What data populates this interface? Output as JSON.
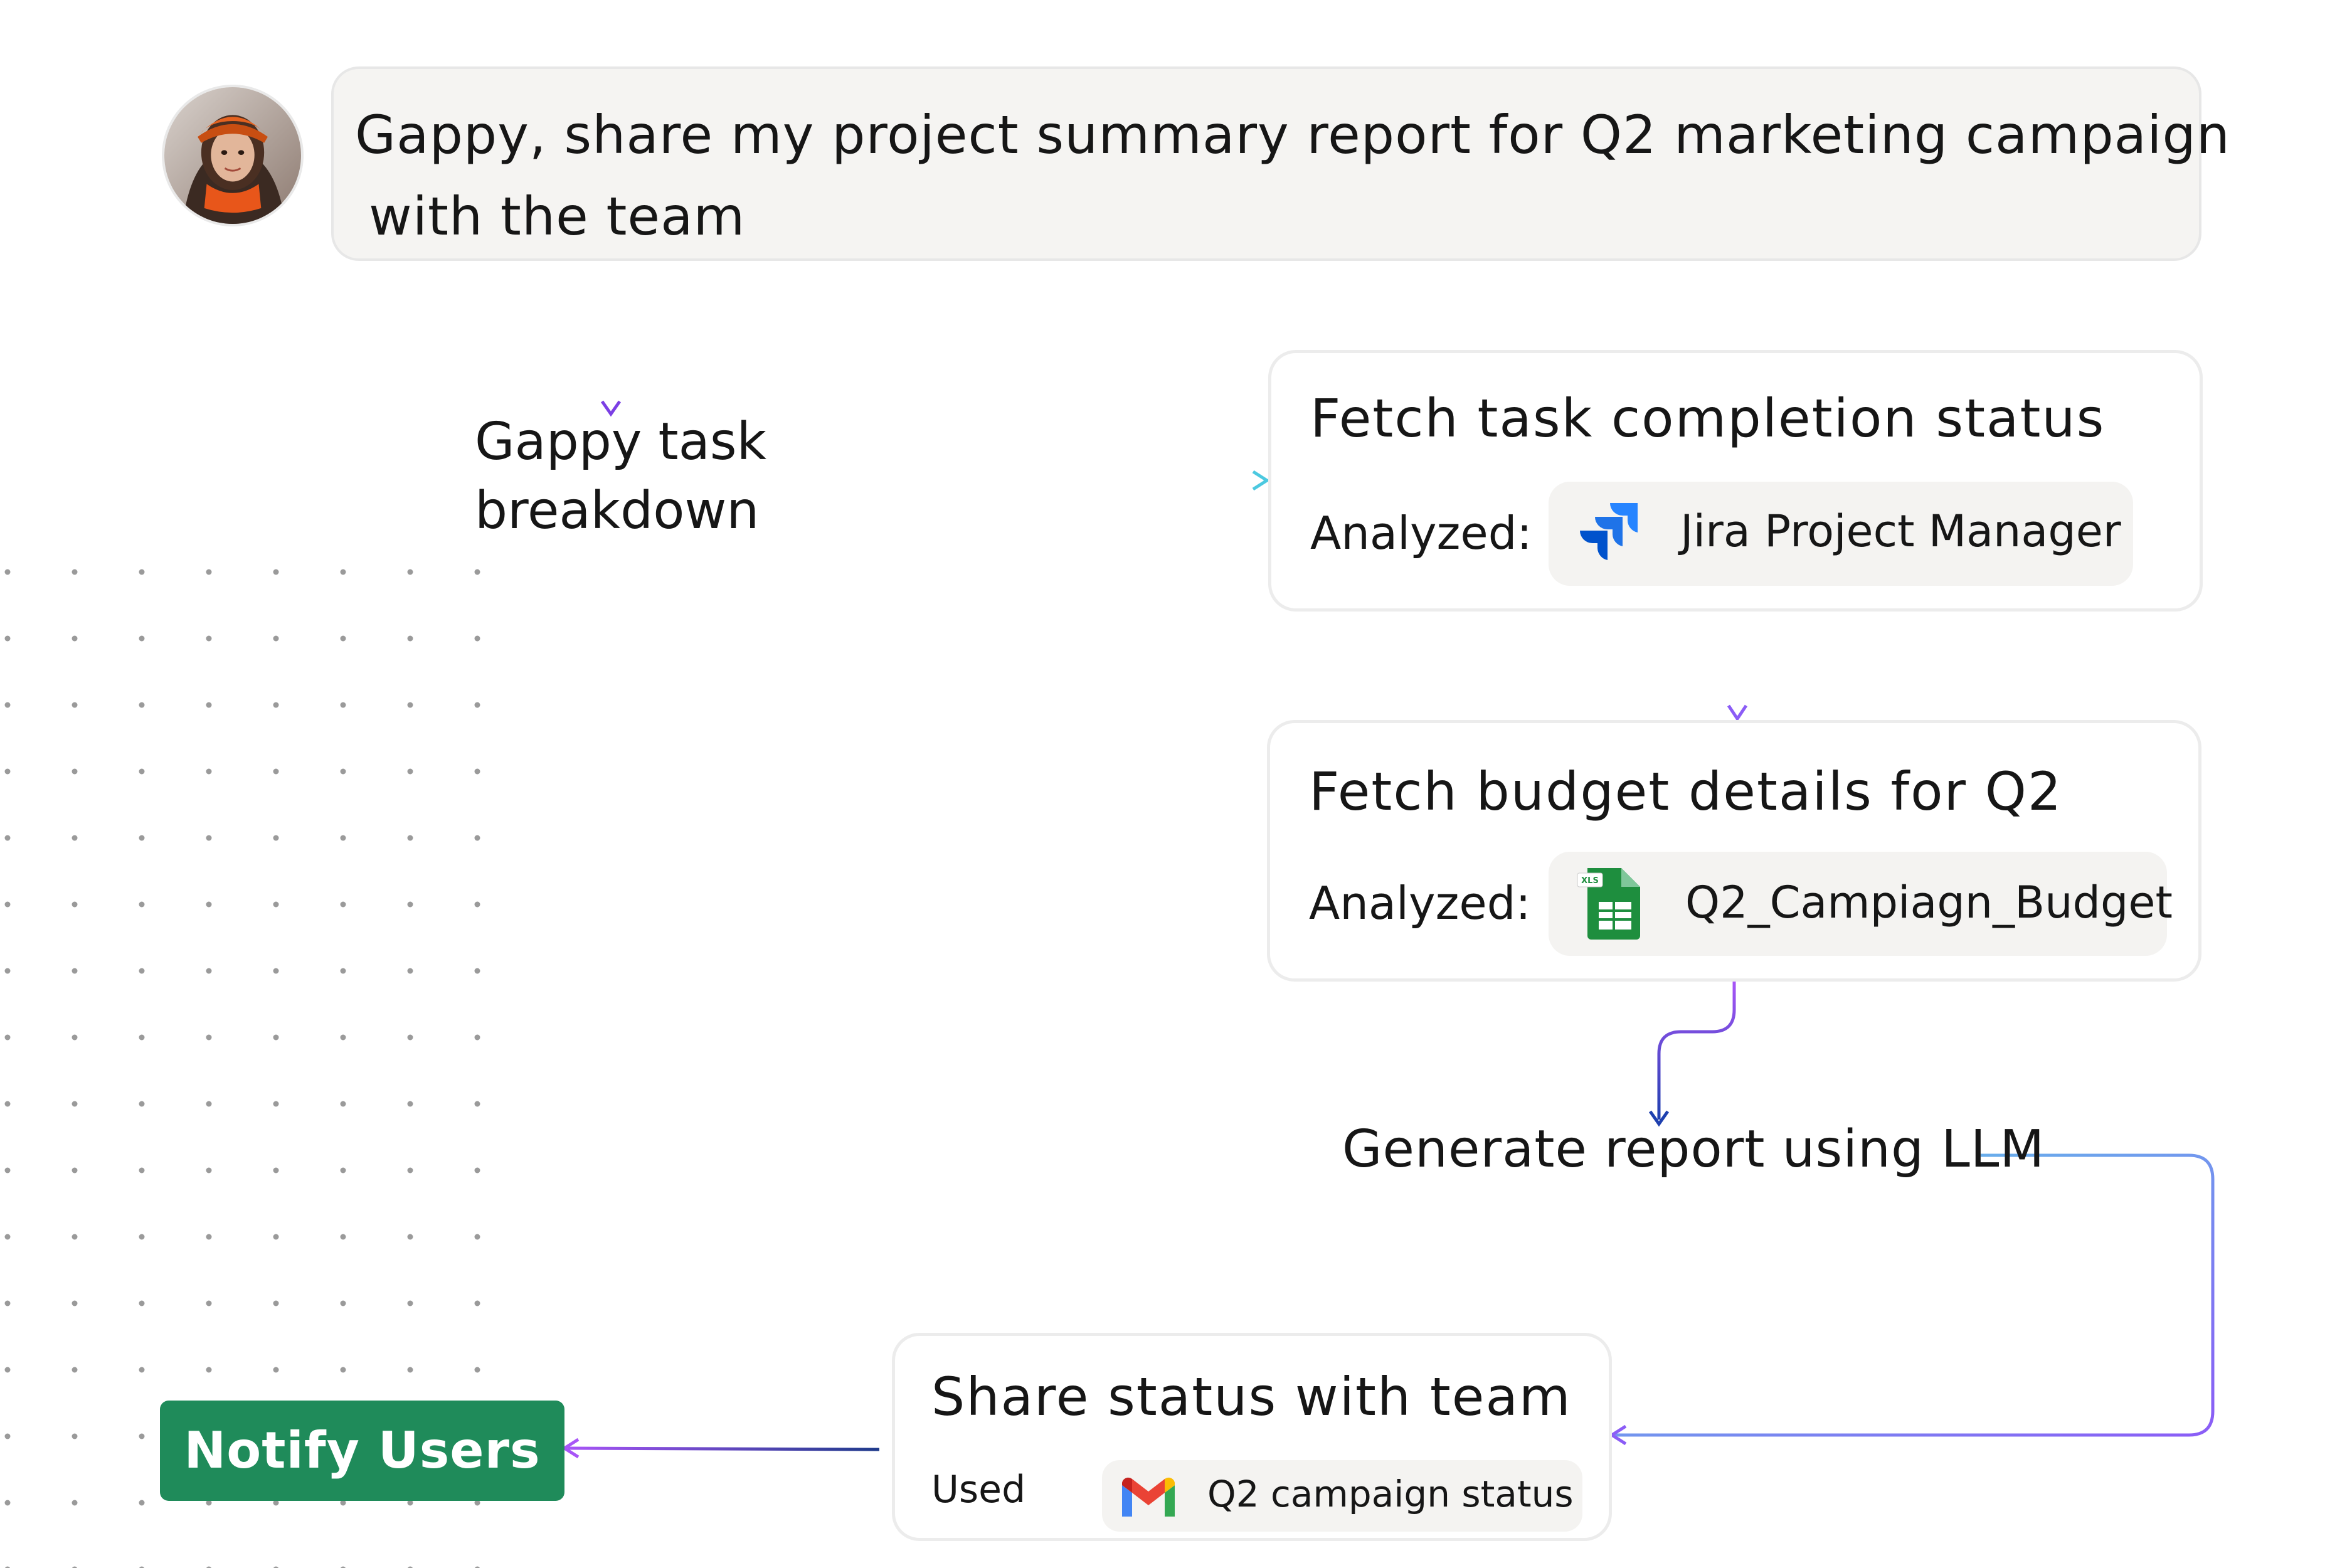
{
  "prompt": {
    "line1": "Gappy, share my project summary report for Q2 marketing campaign",
    "line2": "with the team"
  },
  "breakdown": {
    "line1": "Gappy task",
    "line2": "breakdown"
  },
  "steps": [
    {
      "title": "Fetch task completion status",
      "tag": "Analyzed:",
      "source": "Jira Project Manager",
      "icon": "jira-icon"
    },
    {
      "title": "Fetch budget details for Q2",
      "tag": "Analyzed:",
      "source": "Q2_Campiagn_Budget",
      "icon": "xls-sheet-icon",
      "icon_text": "XLS"
    },
    {
      "title": "Share status with team",
      "tag": "Used",
      "source": "Q2 campaign status",
      "icon": "gmail-icon"
    }
  ],
  "generate_step": "Generate report using LLM",
  "notify_button": "Notify Users",
  "colors": {
    "notify_green": "#1f8b5a",
    "arrow_purple": "#8b5cf6",
    "arrow_cyan": "#5ad1e6",
    "arrow_navy": "#1e3a8a",
    "card_border": "#ececec",
    "prompt_bg": "#f5f4f2"
  }
}
